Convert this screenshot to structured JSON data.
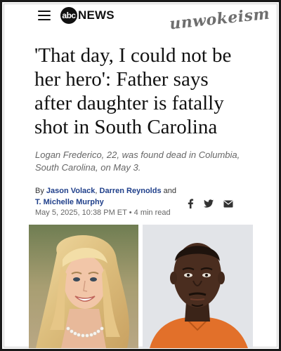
{
  "header": {
    "menu_icon": "hamburger-menu-icon",
    "logo_mark": "abc",
    "logo_word": "NEWS",
    "watermark": "unwokeism"
  },
  "article": {
    "headline": "'That day, I could not be her hero': Father says after daughter is fatally shot in South Carolina",
    "summary": "Logan Frederico, 22, was found dead in Columbia, South Carolina, on May 3.",
    "byline": {
      "prefix": "By",
      "author1": "Jason Volack",
      "sep": ",",
      "author2": "Darren Reynolds",
      "and": "and",
      "author3": "T. Michelle Murphy"
    },
    "date": "May 5, 2025, 10:38 PM ET",
    "read_time": "4 min read",
    "share_icons": [
      "facebook-icon",
      "twitter-icon",
      "email-icon"
    ]
  },
  "colors": {
    "text": "#111111",
    "author_link": "#1f3f8a",
    "muted": "#666666",
    "mugshot_shirt": "#e2702a"
  }
}
